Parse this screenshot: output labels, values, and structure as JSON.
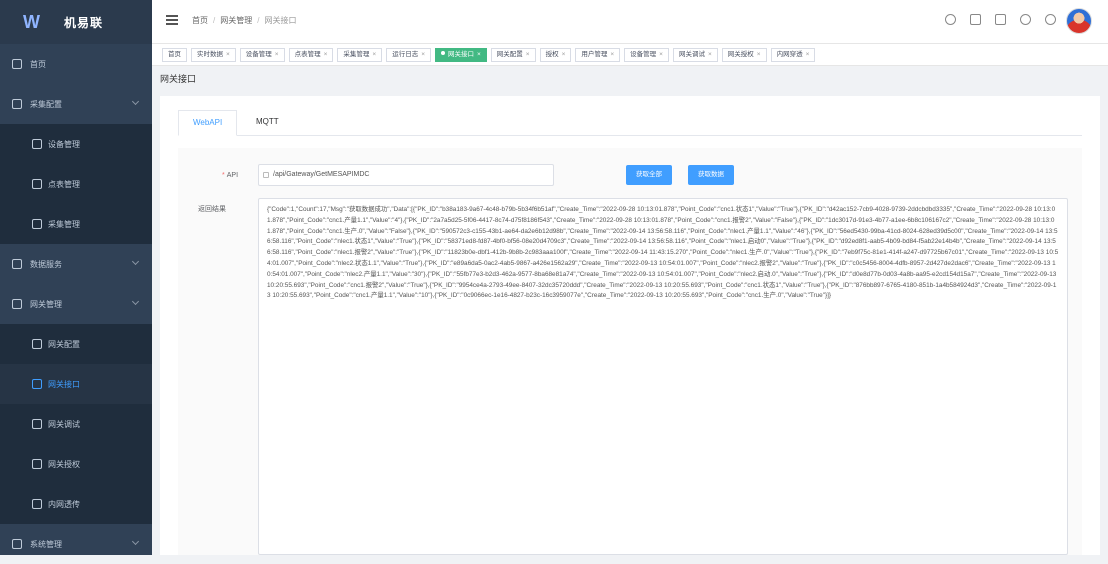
{
  "app": {
    "title": "机易联"
  },
  "sidebar": {
    "items": [
      {
        "label": "首页",
        "level": 1,
        "arrow": false
      },
      {
        "label": "采集配置",
        "level": 1,
        "arrow": true
      },
      {
        "label": "设备管理",
        "level": 2
      },
      {
        "label": "点表管理",
        "level": 2
      },
      {
        "label": "采集管理",
        "level": 2
      },
      {
        "label": "数据服务",
        "level": 1,
        "arrow": true
      },
      {
        "label": "网关管理",
        "level": 1,
        "arrow": true
      },
      {
        "label": "网关配置",
        "level": 2
      },
      {
        "label": "网关接口",
        "level": 2,
        "active": true
      },
      {
        "label": "网关调试",
        "level": 2
      },
      {
        "label": "网关授权",
        "level": 2
      },
      {
        "label": "内网透传",
        "level": 2
      },
      {
        "label": "系统管理",
        "level": 1,
        "arrow": true
      }
    ]
  },
  "header": {
    "breadcrumb": [
      "首页",
      "网关管理",
      "网关接口"
    ]
  },
  "tags": [
    {
      "label": "首页",
      "closable": false
    },
    {
      "label": "实时数据"
    },
    {
      "label": "设备管理"
    },
    {
      "label": "点表管理"
    },
    {
      "label": "采集管理"
    },
    {
      "label": "运行日志"
    },
    {
      "label": "网关接口",
      "active": true
    },
    {
      "label": "网关配置"
    },
    {
      "label": "授权"
    },
    {
      "label": "用户管理"
    },
    {
      "label": "设备管理"
    },
    {
      "label": "网关调试"
    },
    {
      "label": "网关授权"
    },
    {
      "label": "内网穿透"
    }
  ],
  "page": {
    "title": "网关接口"
  },
  "tabs": [
    {
      "label": "WebAPI",
      "active": true
    },
    {
      "label": "MQTT",
      "active": false
    }
  ],
  "form": {
    "api_label": "API",
    "api_value": "/api/Gateway/GetMESAPIMDC",
    "btn_fetch": "获取全部",
    "btn_clear": "获取数据",
    "result_label": "返回结果",
    "result_text": "{\"Code\":1,\"Count\":17,\"Msg\":\"获取数据成功\",\"Data\":[{\"PK_ID\":\"b38a183-9a67-4c48-b79b-5b34f6b51af\",\"Create_Time\":\"2022-09-28 10:13:01.878\",\"Point_Code\":\"cnc1.状态1\",\"Value\":\"True\"},{\"PK_ID\":\"d42ac152-7cb9-4028-9739-2ddcbdbd3335\",\"Create_Time\":\"2022-09-28 10:13:01.878\",\"Point_Code\":\"cnc1.产量1.1\",\"Value\":\"4\"},{\"PK_ID\":\"2a7a5d25-5f06-4417-8c74-d75f8186f543\",\"Create_Time\":\"2022-09-28 10:13:01.878\",\"Point_Code\":\"cnc1.报警2\",\"Value\":\"False\"},{\"PK_ID\":\"1dc3017d-91e3-4b77-a1ee-6b8c106167c2\",\"Create_Time\":\"2022-09-28 10:13:01.878\",\"Point_Code\":\"cnc1.生产.0\",\"Value\":\"False\"},{\"PK_ID\":\"590572c3-c155-43b1-ae64-da2e6b12d98b\",\"Create_Time\":\"2022-09-14 13:56:58.116\",\"Point_Code\":\"nlec1.产量1.1\",\"Value\":\"46\"},{\"PK_ID\":\"56ed5430-99ba-41cd-8024-628ed39d5c00\",\"Create_Time\":\"2022-09-14 13:56:58.116\",\"Point_Code\":\"nlec1.状态1\",\"Value\":\"True\"},{\"PK_ID\":\"58371ed8-fd87-4bf0-bf56-08e20d4709c3\",\"Create_Time\":\"2022-09-14 13:56:58.116\",\"Point_Code\":\"nlec1.启动0\",\"Value\":\"True\"},{\"PK_ID\":\"d92ed8f1-aab5-4b09-bd84-f5ab22e14b4b\",\"Create_Time\":\"2022-09-14 13:56:58.116\",\"Point_Code\":\"nlec1.报警2\",\"Value\":\"True\"},{\"PK_ID\":\"11823b0e-dbf1-412b-9b8b-2c983aaa100f\",\"Create_Time\":\"2022-09-14 11:43:15.270\",\"Point_Code\":\"nlec1.生产.0\",\"Value\":\"True\"},{\"PK_ID\":\"7eb9f75c-81e1-414f-a247-d97725b67c01\",\"Create_Time\":\"2022-09-13 10:54:01.007\",\"Point_Code\":\"nlec2.状态1.1\",\"Value\":\"True\"},{\"PK_ID\":\"e89a6da5-0ac2-4ab5-9867-a426e1562a29\",\"Create_Time\":\"2022-09-13 10:54:01.007\",\"Point_Code\":\"nlec2.报警2\",\"Value\":\"True\"},{\"PK_ID\":\"c0c5456-8004-4dfb-8957-2d427de2dac6\",\"Create_Time\":\"2022-09-13 10:54:01.007\",\"Point_Code\":\"nlec2.产量1.1\",\"Value\":\"30\"},{\"PK_ID\":\"55fb77e3-b2d3-462a-9577-8ba68e81a74\",\"Create_Time\":\"2022-09-13 10:54:01.007\",\"Point_Code\":\"nlec2.启动.0\",\"Value\":\"True\"},{\"PK_ID\":\"d0e8d77b-0d03-4a8b-aa95-e2cd154d15a7\",\"Create_Time\":\"2022-09-13 10:20:55.693\",\"Point_Code\":\"cnc1.报警2\",\"Value\":\"True\"},{\"PK_ID\":\"9954ce4a-2793-49ee-8407-32dc35720ddd\",\"Create_Time\":\"2022-09-13 10:20:55.693\",\"Point_Code\":\"cnc1.状态1\",\"Value\":\"True\"},{\"PK_ID\":\"876bb897-6765-4180-851b-1a4b584924d3\",\"Create_Time\":\"2022-09-13 10:20:55.693\",\"Point_Code\":\"cnc1.产量1.1\",\"Value\":\"10\"},{\"PK_ID\":\"0c9066ec-1e16-4827-b23c-16c3959077e\",\"Create_Time\":\"2022-09-13 10:20:55.693\",\"Point_Code\":\"cnc1.生产.0\",\"Value\":\"True\"}]}"
  }
}
